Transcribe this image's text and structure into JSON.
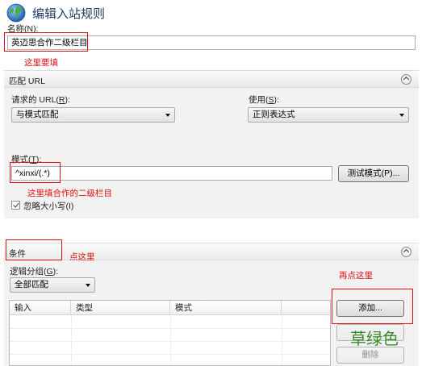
{
  "dialog": {
    "title": "编辑入站规则"
  },
  "name": {
    "label": "名称(",
    "key": "N",
    "suffix": "):",
    "value": "英迈思合作二级栏目"
  },
  "annotations": {
    "name_note": "这里要填",
    "pattern_note": "这里填合作的二级栏目",
    "conditions_note": "点这里",
    "add_note": "再点这里",
    "green_note": "草绿色"
  },
  "match_url": {
    "title": "匹配 URL",
    "requested_label": "请求的 URL(",
    "requested_key": "R",
    "requested_suffix": "):",
    "requested_value": "与模式匹配",
    "using_label": "使用(",
    "using_key": "S",
    "using_suffix": "):",
    "using_value": "正则表达式",
    "pattern_label": "模式(",
    "pattern_key": "T",
    "pattern_suffix": "):",
    "pattern_value": "^xinxi/(.*)",
    "test_button": "测试模式(P)...",
    "ignore_case_label": "忽略大小写(I)",
    "ignore_case_checked": true
  },
  "conditions": {
    "title": "条件",
    "grouping_label": "逻辑分组(",
    "grouping_key": "G",
    "grouping_suffix": "):",
    "grouping_value": "全部匹配",
    "columns": [
      "输入",
      "类型",
      "模式"
    ],
    "add_button": "添加...",
    "delete_button": "删除"
  },
  "colors": {
    "annotation_red": "#e01010",
    "green_text": "#3a8a2a",
    "section_bg": "#f2f2f2"
  }
}
